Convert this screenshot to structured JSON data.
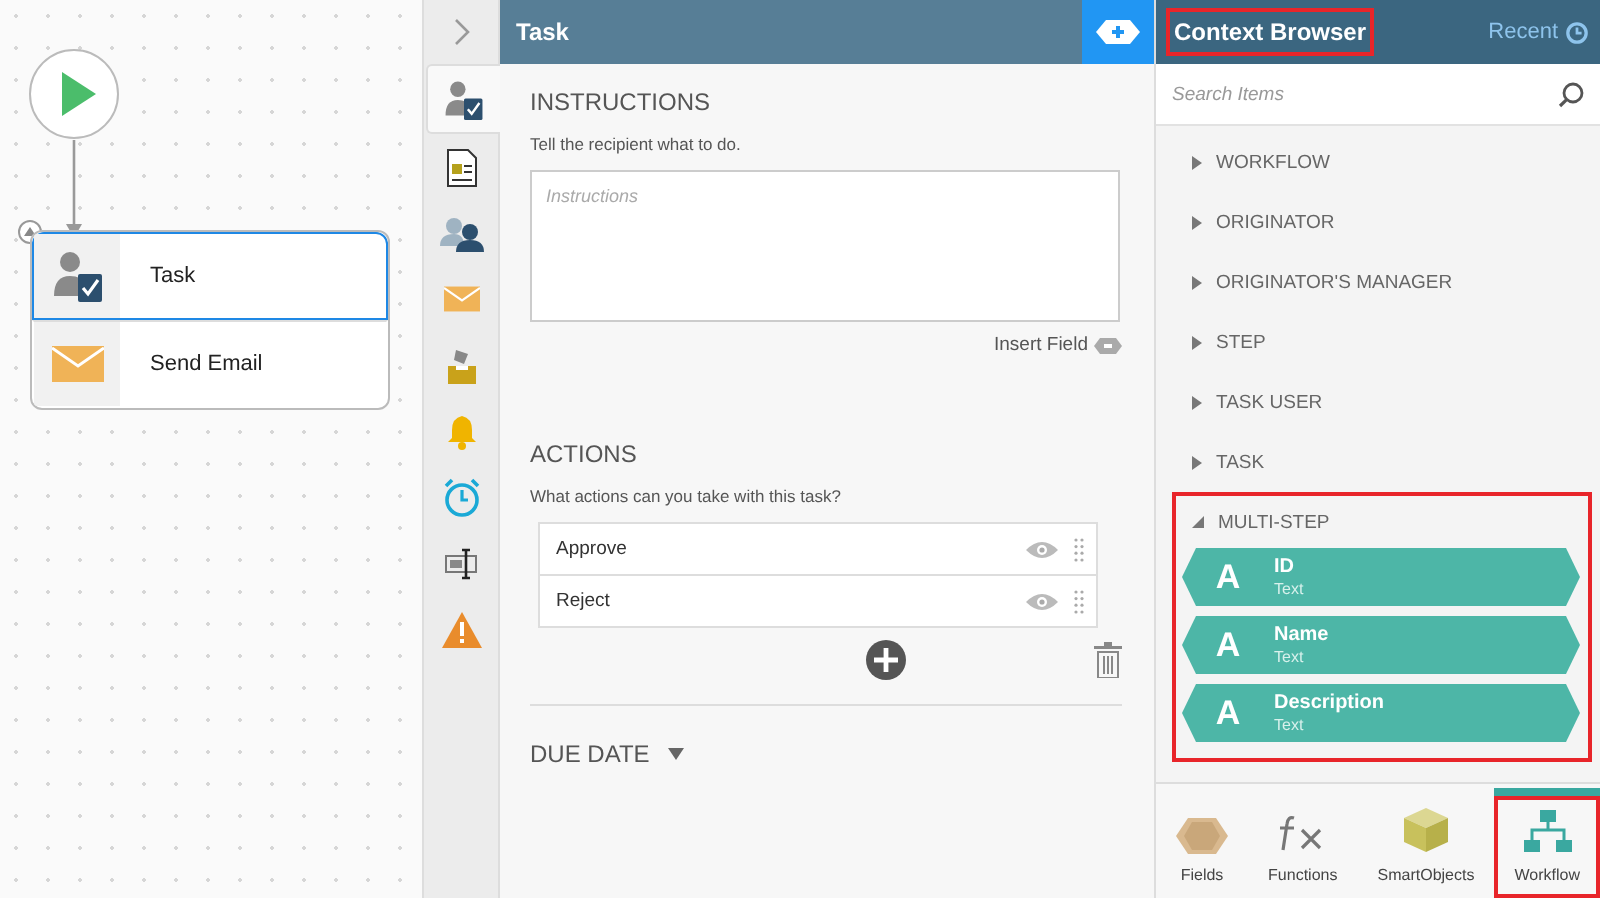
{
  "canvas": {
    "steps": [
      {
        "label": "Task",
        "kind": "task",
        "selected": true
      },
      {
        "label": "Send Email",
        "kind": "email",
        "selected": false
      }
    ]
  },
  "side_tabs": [
    {
      "kind": "task",
      "selected": true
    },
    {
      "kind": "form",
      "selected": false
    },
    {
      "kind": "users",
      "selected": false
    },
    {
      "kind": "email",
      "selected": false
    },
    {
      "kind": "inbox",
      "selected": false
    },
    {
      "kind": "bell",
      "selected": false
    },
    {
      "kind": "timer",
      "selected": false
    },
    {
      "kind": "textbox",
      "selected": false
    },
    {
      "kind": "warning",
      "selected": false
    }
  ],
  "task_panel": {
    "title": "Task",
    "instructions": {
      "heading": "INSTRUCTIONS",
      "description": "Tell the recipient what to do.",
      "placeholder": "Instructions",
      "insert_field": "Insert Field"
    },
    "actions": {
      "heading": "ACTIONS",
      "description": "What actions can you take with this task?",
      "items": [
        "Approve",
        "Reject"
      ]
    },
    "due_date": {
      "heading": "DUE DATE",
      "expanded": false
    }
  },
  "context_browser": {
    "title": "Context Browser",
    "highlighted": true,
    "recent": "Recent",
    "search": {
      "placeholder": "Search Items"
    },
    "tree": [
      {
        "label": "WORKFLOW",
        "expanded": false,
        "highlighted": false
      },
      {
        "label": "ORIGINATOR",
        "expanded": false,
        "highlighted": false
      },
      {
        "label": "ORIGINATOR'S MANAGER",
        "expanded": false,
        "highlighted": false
      },
      {
        "label": "STEP",
        "expanded": false,
        "highlighted": false
      },
      {
        "label": "TASK USER",
        "expanded": false,
        "highlighted": false
      },
      {
        "label": "TASK",
        "expanded": false,
        "highlighted": false
      },
      {
        "label": "MULTI-STEP",
        "expanded": true,
        "highlighted": true,
        "children": [
          {
            "icon": "A",
            "name": "ID",
            "type": "Text"
          },
          {
            "icon": "A",
            "name": "Name",
            "type": "Text"
          },
          {
            "icon": "A",
            "name": "Description",
            "type": "Text"
          }
        ]
      }
    ],
    "bottom_tabs": [
      {
        "label": "Fields",
        "kind": "fields",
        "selected": false,
        "highlighted": false
      },
      {
        "label": "Functions",
        "kind": "functions",
        "selected": false,
        "highlighted": false
      },
      {
        "label": "SmartObjects",
        "kind": "smartobjects",
        "selected": false,
        "highlighted": false
      },
      {
        "label": "Workflow",
        "kind": "workflow",
        "selected": true,
        "highlighted": true
      }
    ]
  }
}
